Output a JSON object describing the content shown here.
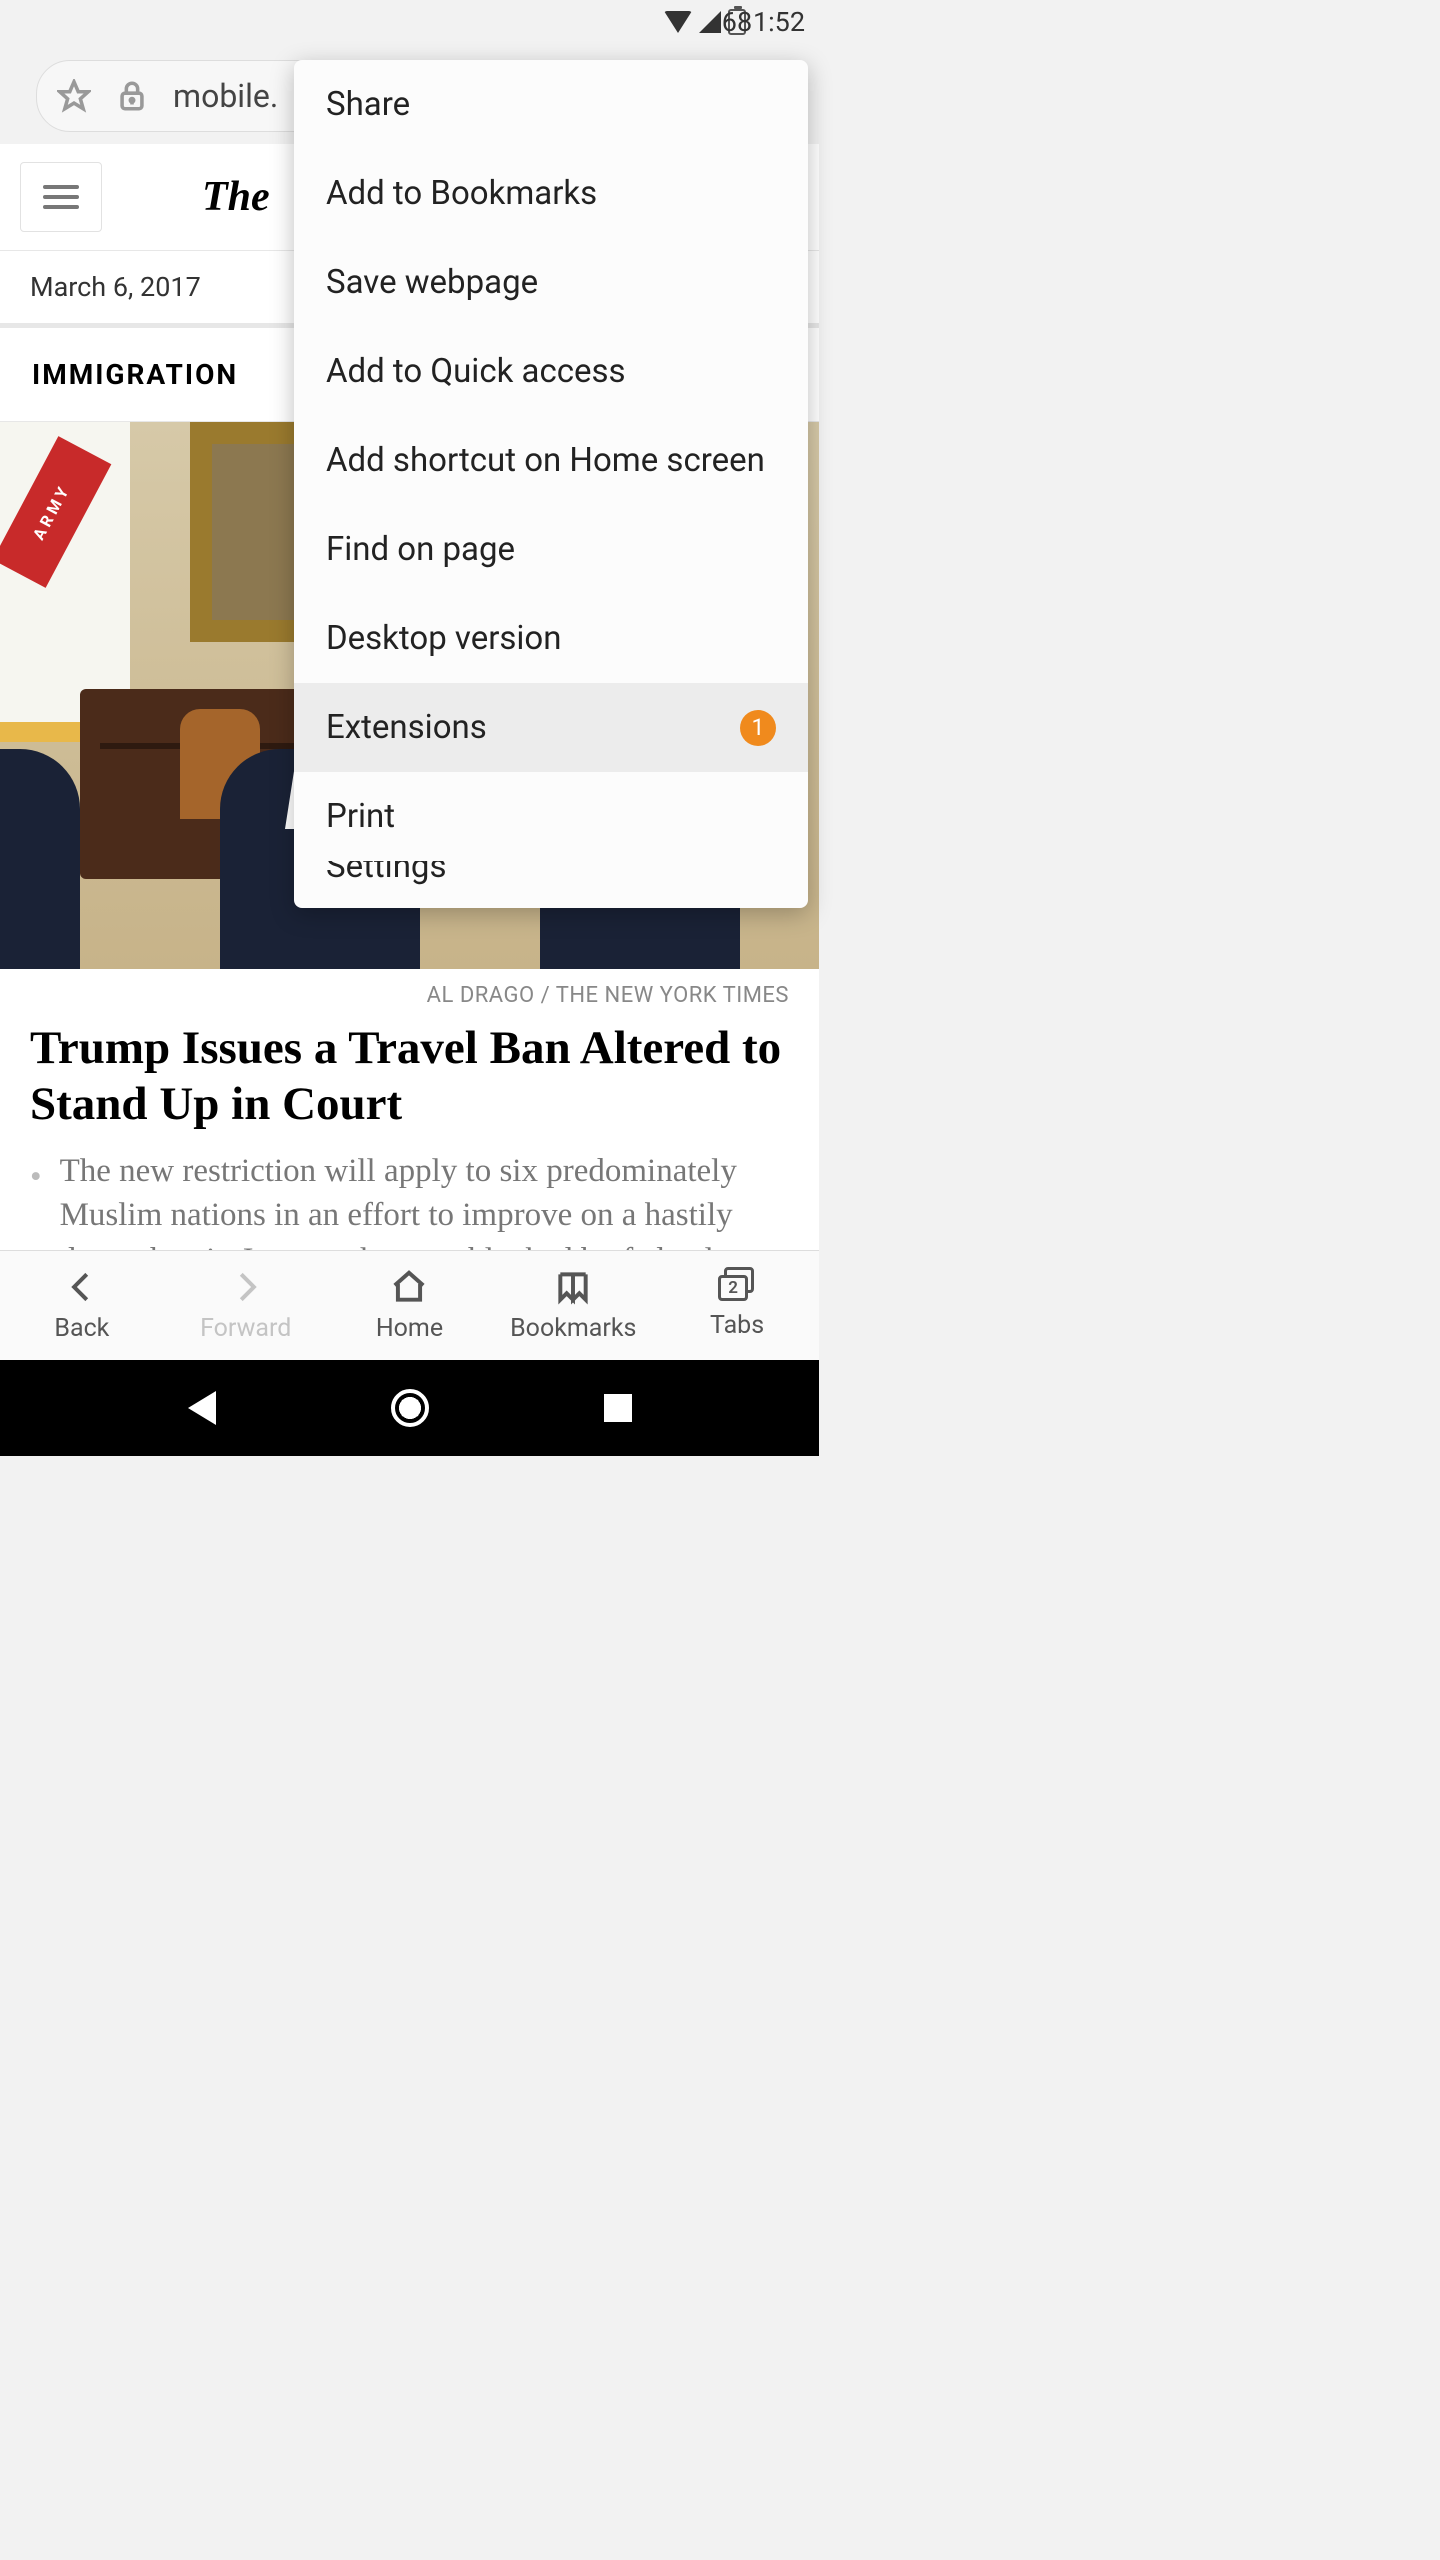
{
  "status": {
    "battery_pct": "68",
    "time": "1:52"
  },
  "address_bar": {
    "url_text": "mobile."
  },
  "page": {
    "brand_partial": "The",
    "date": "March 6, 2017",
    "section": "IMMIGRATION",
    "flag_text": "ARMY",
    "credit": "AL DRAGO / THE NEW YORK TIMES",
    "headline": "Trump Issues a Travel Ban Altered to Stand Up in Court",
    "bullet": "The new restriction will apply to six predominately Muslim nations in an effort to improve on a hastily drawn ban in January that was blocked by federal judges."
  },
  "menu": {
    "items": [
      {
        "label": "Share",
        "highlight": false
      },
      {
        "label": "Add to Bookmarks",
        "highlight": false
      },
      {
        "label": "Save webpage",
        "highlight": false
      },
      {
        "label": "Add to Quick access",
        "highlight": false
      },
      {
        "label": "Add shortcut on Home screen",
        "highlight": false
      },
      {
        "label": "Find on page",
        "highlight": false
      },
      {
        "label": "Desktop version",
        "highlight": false
      },
      {
        "label": "Extensions",
        "highlight": true,
        "badge": "1"
      },
      {
        "label": "Print",
        "highlight": false
      },
      {
        "label": "Settings",
        "highlight": false,
        "cut": true
      }
    ]
  },
  "nav": {
    "back": "Back",
    "forward": "Forward",
    "home": "Home",
    "bookmarks": "Bookmarks",
    "tabs": "Tabs",
    "tab_count": "2"
  }
}
